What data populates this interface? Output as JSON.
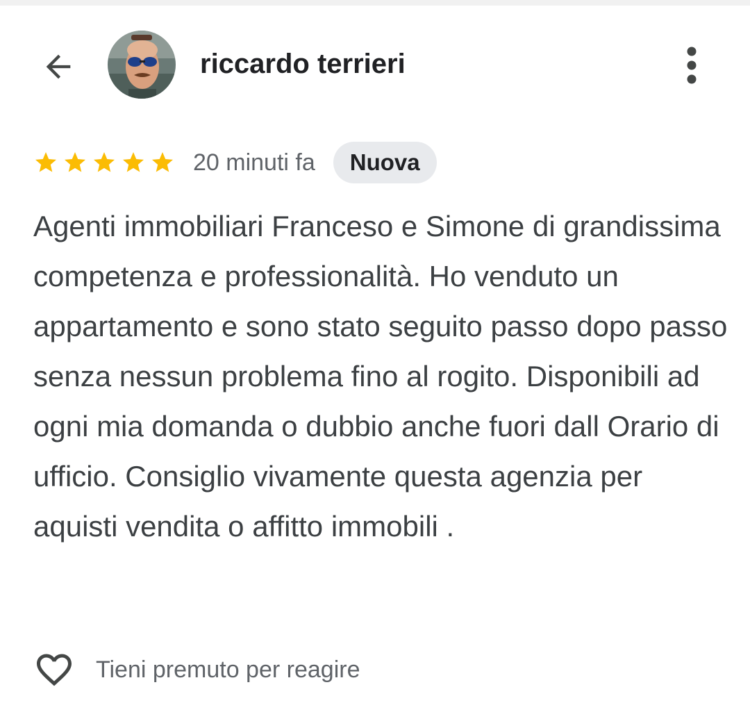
{
  "header": {
    "back_icon": "arrow-back-icon",
    "author_name": "riccardo terrieri",
    "more_icon": "more-vert-icon"
  },
  "review": {
    "rating": 5,
    "rating_max": 5,
    "star_color": "#fbbc04",
    "time_ago": "20 minuti fa",
    "badge": "Nuova",
    "text": "Agenti immobiliari Franceso e Simone di grandissima competenza e professionalità. Ho venduto un appartamento e sono stato seguito passo dopo passo senza nessun problema fino al rogito. Disponibili ad ogni mia domanda o dubbio anche fuori dall Orario di ufficio. Consiglio vivamente questa agenzia per aquisti vendita o affitto immobili ."
  },
  "reaction": {
    "icon": "heart-outline-icon",
    "label": "Tieni premuto per reagire"
  },
  "colors": {
    "text_primary": "#202124",
    "text_secondary": "#5f6368",
    "badge_bg": "#e8eaed",
    "star": "#fbbc04"
  }
}
